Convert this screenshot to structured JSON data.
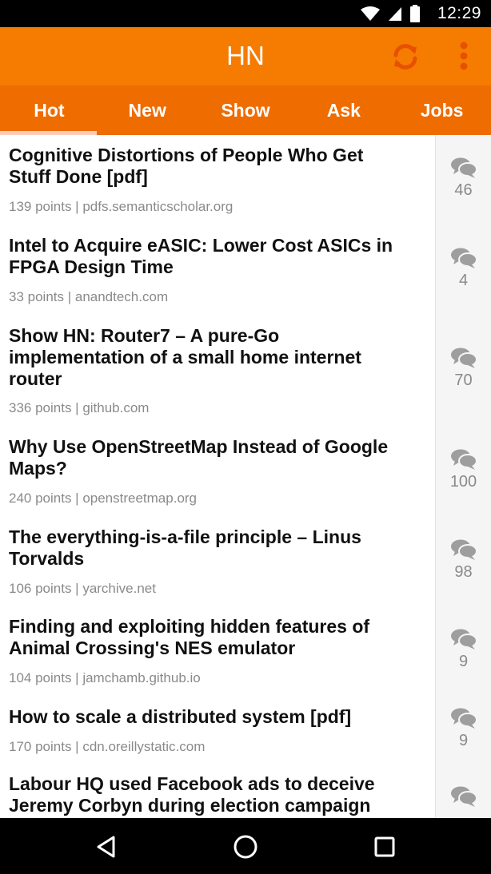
{
  "status_bar": {
    "time": "12:29",
    "icons": [
      "wifi-icon",
      "signal-icon",
      "battery-icon"
    ]
  },
  "app_bar": {
    "title": "HN",
    "actions": [
      "refresh-icon",
      "more-vert-icon"
    ]
  },
  "tabs": [
    {
      "label": "Hot",
      "selected": true
    },
    {
      "label": "New",
      "selected": false
    },
    {
      "label": "Show",
      "selected": false
    },
    {
      "label": "Ask",
      "selected": false
    },
    {
      "label": "Jobs",
      "selected": false
    }
  ],
  "stories": [
    {
      "title_lines": [
        "Cognitive Distortions of People Who Get",
        "Stuff Done [pdf]"
      ],
      "meta": "139 points | pdfs.semanticscholar.org",
      "comments": "46"
    },
    {
      "title_lines": [
        "Intel to Acquire eASIC: Lower Cost ASICs in",
        "FPGA Design Time"
      ],
      "meta": "33 points | anandtech.com",
      "comments": "4"
    },
    {
      "title_lines": [
        "Show HN: Router7 – A pure-Go",
        "implementation of a small home internet",
        "router"
      ],
      "meta": "336 points | github.com",
      "comments": "70"
    },
    {
      "title_lines": [
        "Why Use OpenStreetMap Instead of Google",
        "Maps?"
      ],
      "meta": "240 points | openstreetmap.org",
      "comments": "100"
    },
    {
      "title_lines": [
        "The everything-is-a-file principle – Linus",
        "Torvalds"
      ],
      "meta": "106 points | yarchive.net",
      "comments": "98"
    },
    {
      "title_lines": [
        "Finding and exploiting hidden features of",
        "Animal Crossing's NES emulator"
      ],
      "meta": "104 points | jamchamb.github.io",
      "comments": "9"
    },
    {
      "title_lines": [
        "How to scale a distributed system [pdf]"
      ],
      "meta": "170 points | cdn.oreillystatic.com",
      "comments": "9"
    },
    {
      "title_lines": [
        "Labour HQ used Facebook ads to deceive",
        "Jeremy Corbyn during election campaign"
      ],
      "meta": "",
      "comments": ""
    }
  ],
  "nav_bar": {
    "buttons": [
      "back-icon",
      "home-icon",
      "recents-icon"
    ]
  },
  "colors": {
    "app_bar": "#f57c00",
    "tabs": "#ef6c00",
    "refresh": "#e65100",
    "indicator": "#ffccbc",
    "comment_icon": "#9e9e9e"
  }
}
